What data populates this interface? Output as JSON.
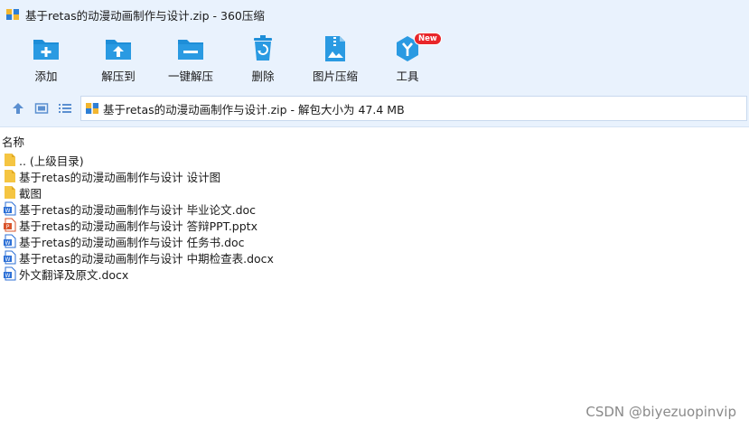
{
  "window": {
    "title": "基于retas的动漫动画制作与设计.zip - 360压缩",
    "app_icon": "archive-icon"
  },
  "toolbar": {
    "items": [
      {
        "label": "添加",
        "icon": "add-folder-icon"
      },
      {
        "label": "解压到",
        "icon": "extract-to-icon"
      },
      {
        "label": "一键解压",
        "icon": "one-click-extract-icon"
      },
      {
        "label": "删除",
        "icon": "recycle-bin-icon"
      },
      {
        "label": "图片压缩",
        "icon": "image-compress-icon"
      },
      {
        "label": "工具",
        "icon": "tools-icon",
        "badge": "New"
      }
    ]
  },
  "nav": {
    "address": "基于retas的动漫动画制作与设计.zip - 解包大小为 47.4 MB",
    "buttons": [
      "up-arrow-icon",
      "thumbnail-view-icon",
      "list-view-icon"
    ]
  },
  "list": {
    "column_name": "名称",
    "rows": [
      {
        "name": ".. (上级目录)",
        "type": "folder"
      },
      {
        "name": "基于retas的动漫动画制作与设计 设计图",
        "type": "folder"
      },
      {
        "name": "截图",
        "type": "folder"
      },
      {
        "name": "基于retas的动漫动画制作与设计 毕业论文.doc",
        "type": "word"
      },
      {
        "name": "基于retas的动漫动画制作与设计 答辩PPT.pptx",
        "type": "ppt"
      },
      {
        "name": "基于retas的动漫动画制作与设计 任务书.doc",
        "type": "word"
      },
      {
        "name": "基于retas的动漫动画制作与设计 中期检查表.docx",
        "type": "word"
      },
      {
        "name": "外文翻译及原文.docx",
        "type": "word"
      }
    ]
  },
  "watermark": "CSDN @biyezuopinvip",
  "colors": {
    "toolbar_bg": "#e9f2fd",
    "icon_blue": "#1e8ed8",
    "badge_red": "#e8262a",
    "folder_yellow": "#f5c542",
    "ppt_orange": "#d9542b",
    "word_blue": "#2b6fd6"
  }
}
